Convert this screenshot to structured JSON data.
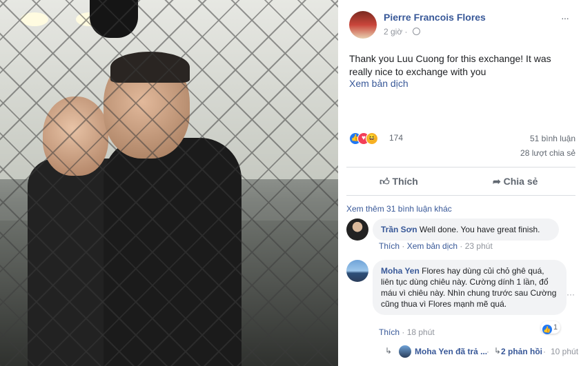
{
  "post": {
    "author": "Pierre Francois Flores",
    "time": "2 giờ",
    "text": "Thank you Luu Cuong for this exchange! It was really nice to exchange with you",
    "translate": "Xem bản dịch",
    "more_icon": "···"
  },
  "stats": {
    "reaction_count": "174",
    "comments": "51 bình luận",
    "shares": "28 lượt chia sẻ",
    "reactions": [
      "like-icon",
      "love-icon",
      "haha-icon"
    ]
  },
  "actions": {
    "like": "Thích",
    "share": "Chia sẻ"
  },
  "comments_section": {
    "more_comments": "Xem thêm 31 bình luận khác",
    "items": [
      {
        "name": "Trần Sơn",
        "text": "Well done. You have great finish.",
        "like": "Thích",
        "translate": "Xem bản dịch",
        "time": "23 phút"
      },
      {
        "name": "Moha Yen",
        "text": "Flores hay dùng củi chỏ ghê quá, liên tục dùng chiêu này. Cường dính 1 lần, đổ máu vì chiêu này. Nhìn chung trước sau Cường cũng thua vì Flores mạnh mẽ quá.",
        "like": "Thích",
        "time": "18 phút",
        "reaction_count": "1",
        "reply_preview": "Moha Yen đã trả ...",
        "reply_count": "2 phản hồi",
        "reply_time": "10 phút"
      }
    ]
  }
}
